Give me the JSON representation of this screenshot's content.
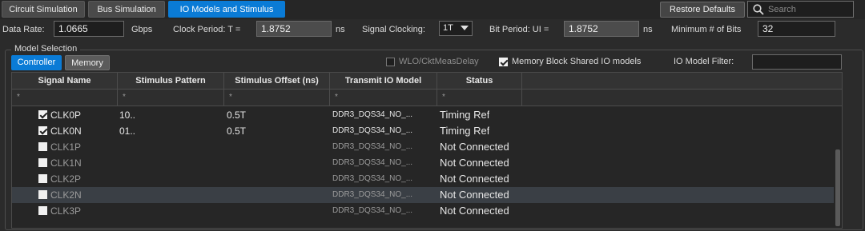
{
  "tabs": [
    {
      "label": "Circuit Simulation",
      "active": false
    },
    {
      "label": "Bus Simulation",
      "active": false
    },
    {
      "label": "IO Models and Stimulus",
      "active": true
    }
  ],
  "toolbar": {
    "restore_label": "Restore Defaults",
    "search_placeholder": "Search"
  },
  "params": {
    "data_rate_label": "Data Rate:",
    "data_rate_value": "1.0665",
    "data_rate_unit": "Gbps",
    "clock_period_label": "Clock Period: T =",
    "clock_period_value": "1.8752",
    "clock_period_unit": "ns",
    "signal_clocking_label": "Signal Clocking:",
    "signal_clocking_value": "1T",
    "bit_period_label": "Bit Period: UI =",
    "bit_period_value": "1.8752",
    "bit_period_unit": "ns",
    "min_bits_label": "Minimum # of Bits",
    "min_bits_value": "32"
  },
  "model_selection": {
    "title": "Model Selection",
    "subtabs": [
      "Controller",
      "Memory"
    ],
    "wlo_label": "WLO/CktMeasDelay",
    "wlo_checked": false,
    "mem_shared_label": "Memory Block Shared IO models",
    "mem_shared_checked": true,
    "filter_label": "IO Model Filter:",
    "filter_value": ""
  },
  "grid": {
    "columns": [
      "Signal Name",
      "Stimulus Pattern",
      "Stimulus Offset (ns)",
      "Transmit IO Model",
      "Status"
    ],
    "filters": [
      "*",
      "*",
      "*",
      "*",
      "*"
    ],
    "rows": [
      {
        "name": "CLK0P",
        "checked": true,
        "pattern": "10..",
        "offset": "0.5T",
        "model": "DDR3_DQS34_NO_...",
        "status": "Timing Ref",
        "dim": false
      },
      {
        "name": "CLK0N",
        "checked": true,
        "pattern": "01..",
        "offset": "0.5T",
        "model": "DDR3_DQS34_NO_...",
        "status": "Timing Ref",
        "dim": false
      },
      {
        "name": "CLK1P",
        "checked": false,
        "pattern": "",
        "offset": "",
        "model": "DDR3_DQS34_NO_...",
        "status": "Not Connected",
        "dim": true
      },
      {
        "name": "CLK1N",
        "checked": false,
        "pattern": "",
        "offset": "",
        "model": "DDR3_DQS34_NO_...",
        "status": "Not Connected",
        "dim": true
      },
      {
        "name": "CLK2P",
        "checked": false,
        "pattern": "",
        "offset": "",
        "model": "DDR3_DQS34_NO_...",
        "status": "Not Connected",
        "dim": true
      },
      {
        "name": "CLK2N",
        "checked": false,
        "pattern": "",
        "offset": "",
        "model": "DDR3_DQS34_NO_...",
        "status": "Not Connected",
        "dim": true,
        "selected": true
      },
      {
        "name": "CLK3P",
        "checked": false,
        "pattern": "",
        "offset": "",
        "model": "DDR3_DQS34_NO_...",
        "status": "Not Connected",
        "dim": true
      }
    ]
  },
  "colors": {
    "accent": "#0a7bd6",
    "background": "#2b2b2b",
    "dim_text": "#9b9b9b"
  }
}
